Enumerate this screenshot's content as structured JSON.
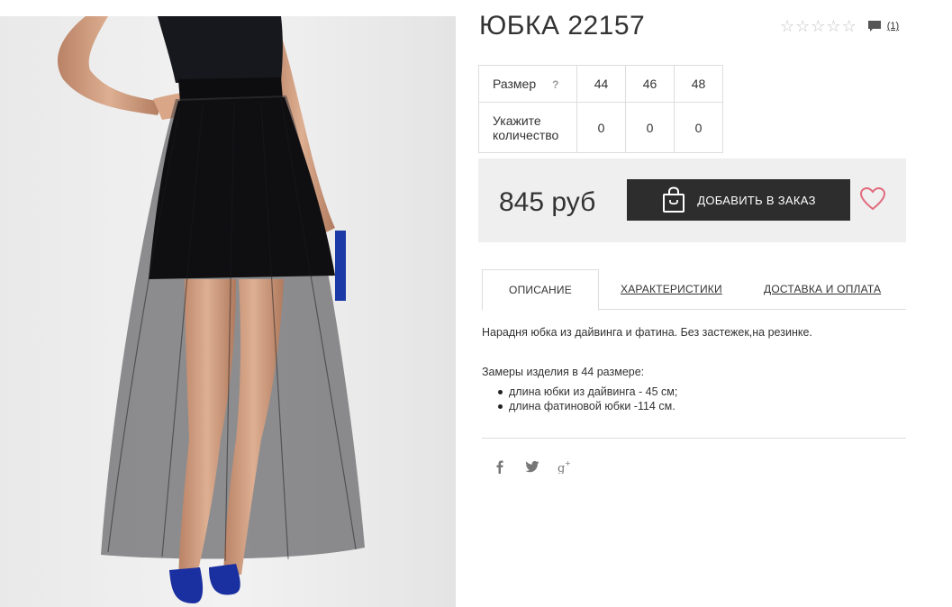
{
  "product": {
    "title": "ЮБКА 22157",
    "rating_stars": 0,
    "rating_max": 5,
    "review_count": "(1)"
  },
  "size_table": {
    "size_label": "Размер",
    "help": "?",
    "sizes": [
      "44",
      "46",
      "48"
    ],
    "qty_label": "Укажите количество",
    "quantities": [
      "0",
      "0",
      "0"
    ]
  },
  "purchase": {
    "price": "845 руб",
    "add_button": "ДОБАВИТЬ В ЗАКАЗ"
  },
  "tabs": [
    {
      "label": "ОПИСАНИЕ",
      "active": true
    },
    {
      "label": "ХАРАКТЕРИСТИКИ",
      "active": false
    },
    {
      "label": "ДОСТАВКА И ОПЛАТА",
      "active": false
    }
  ],
  "description": {
    "text": "Нарадня юбка из дайвинга и фатина. Без застежек,на резинке.",
    "measurements_title": "Замеры изделия в 44 размере:",
    "measurements": [
      "длина юбки из дайвинга - 45 см;",
      "длина фатиновой юбки -114 см."
    ]
  },
  "social": [
    "facebook-icon",
    "twitter-icon",
    "google-plus-icon"
  ],
  "colors": {
    "button_bg": "#2d2d2d",
    "price_box_bg": "#efefef",
    "heart": "#e06a7c",
    "star_empty": "#c4c4c4"
  }
}
